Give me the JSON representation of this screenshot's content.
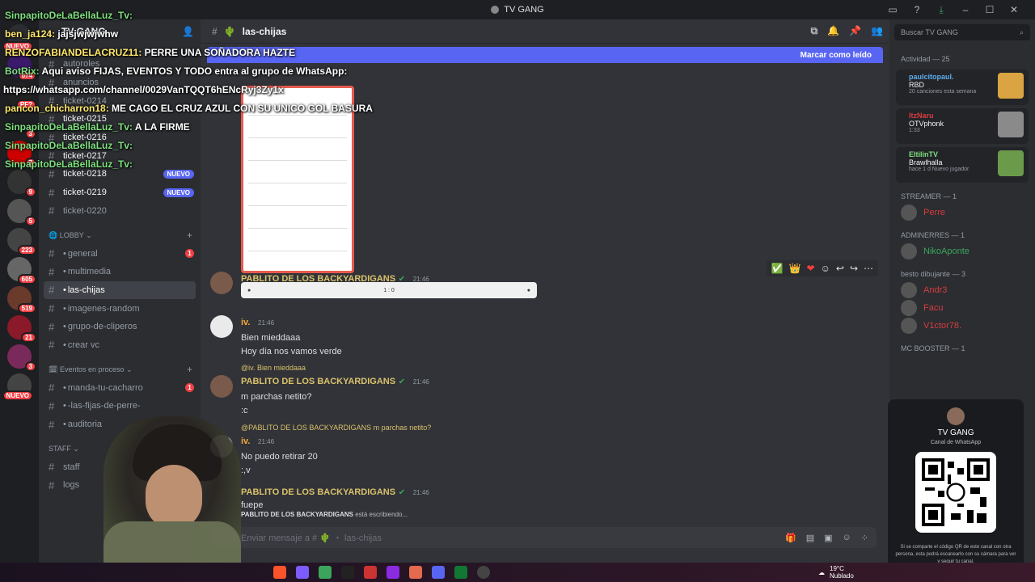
{
  "window": {
    "title": "TV GANG"
  },
  "server": {
    "name": "TV GANG"
  },
  "channels": [
    {
      "name": "autoroles",
      "hash": "#",
      "bright": false
    },
    {
      "name": "anuncios",
      "hash": "#",
      "bright": false
    },
    {
      "name": "ticket-0214",
      "hash": "#",
      "bright": false
    },
    {
      "name": "ticket-0215",
      "hash": "#",
      "bright": true
    },
    {
      "name": "ticket-0216",
      "hash": "#",
      "bright": true
    },
    {
      "name": "ticket-0217",
      "hash": "#",
      "bright": true
    },
    {
      "name": "ticket-0218",
      "hash": "#",
      "bright": true,
      "badge": "NUEVO"
    },
    {
      "name": "ticket-0219",
      "hash": "#",
      "bright": true,
      "badge": "NUEVO"
    },
    {
      "name": "ticket-0220",
      "hash": "#",
      "bright": false
    }
  ],
  "lobby": {
    "label": "LOBBY",
    "items": [
      {
        "name": "general",
        "count": "1"
      },
      {
        "name": "multimedia"
      },
      {
        "name": "las-chijas",
        "active": true
      },
      {
        "name": "imagenes-random"
      },
      {
        "name": "grupo-de-cliperos"
      },
      {
        "name": "crear vc"
      }
    ]
  },
  "events": {
    "label": "Eventos en proceso",
    "items": [
      {
        "name": "manda-tu-cacharro",
        "count": "1"
      },
      {
        "name": "-las-fijas-de-perre-"
      },
      {
        "name": "auditoria"
      }
    ]
  },
  "staff": {
    "label": "STAFF",
    "items": [
      {
        "name": "staff"
      },
      {
        "name": "logs"
      }
    ]
  },
  "server_badges": [
    "NUEVO",
    "674",
    "PF?",
    "3",
    "7",
    "9",
    "5",
    "223",
    "605",
    "519",
    "21",
    "3",
    "NUEVO"
  ],
  "main": {
    "channel": "las-chijas",
    "newbar_mark": "Marcar como leído",
    "messages": [
      {
        "author": "PABLITO DE LOS BACKYARDIGANS",
        "time": "21:46",
        "text": ""
      },
      {
        "author": "iv.",
        "time": "21:46",
        "lines": [
          "Bien mieddaaa",
          "Hoy día nos vamos verde"
        ]
      },
      {
        "reply": "@iv. Bien mieddaaa",
        "author": "PABLITO DE LOS BACKYARDIGANS",
        "time": "21:46",
        "lines": [
          "m parchas netito?",
          ":c"
        ]
      },
      {
        "reply": "@PABLITO DE LOS BACKYARDIGANS m parchas netito?",
        "author": "iv.",
        "time": "21:46",
        "lines": [
          "No puedo retirar 20",
          ":,v"
        ]
      },
      {
        "author": "PABLITO DE LOS BACKYARDIGANS",
        "time": "21:46",
        "lines": [
          "fuepe"
        ]
      }
    ],
    "typing": {
      "who": "PABLITO DE LOS BACKYARDIGANS",
      "text": " está escribiendo..."
    },
    "composer_placeholder": "Enviar mensaje a # 🌵 ・ las-chijas"
  },
  "members": {
    "search_placeholder": "Buscar TV GANG",
    "activity_label": "Actividad — 25",
    "activities": [
      {
        "name": "paulcitopaul.",
        "title": "RBD",
        "detail": "20 canciones esta semana",
        "color": "#5dadec"
      },
      {
        "name": "ItzNaru",
        "title": "OTVphonk",
        "detail": "1:33",
        "color": "#d83c3e"
      },
      {
        "name": "EltilinTV",
        "title": "Brawlhalla",
        "detail": "hace 1 d    Nuevo jugador",
        "color": "#7fe07f"
      }
    ],
    "groups": [
      {
        "label": "STREAMER — 1",
        "members": [
          {
            "name": "Perre",
            "color": "#d83c3e"
          }
        ]
      },
      {
        "label": "ADMINERRES — 1",
        "members": [
          {
            "name": "NikoAponte",
            "color": "#3ba55d"
          }
        ]
      },
      {
        "label": "besto dibujante — 3",
        "members": [
          {
            "name": "Andr3",
            "color": "#d83c3e"
          },
          {
            "name": "Facu",
            "color": "#d83c3e"
          },
          {
            "name": "V1ctor78.",
            "color": "#d83c3e"
          }
        ]
      },
      {
        "label": "MC BOOSTER — 1",
        "members": []
      }
    ]
  },
  "qr": {
    "title": "TV GANG",
    "subtitle": "Canal de WhatsApp",
    "note": "Si se comparte el código QR de este canal con otra persona, esta podrá escanearlo con su cámara para ver y seguir tu canal."
  },
  "overlay": [
    {
      "user": "SinpapitoDeLaBellaLuz_Tv:",
      "text": "",
      "color": "#7fe07f"
    },
    {
      "user": "ben_ja124:",
      "text": " jajsjwjwjwhw",
      "color": "#ffe86b"
    },
    {
      "user": "RENZOFABIANDELACRUZ11:",
      "text": " PERRE UNA SOÑADORA HAZTE",
      "color": "#ffe86b"
    },
    {
      "user": "BotRix:",
      "text": " Aqui aviso FIJAS, EVENTOS Y TODO entra al grupo de WhatsApp:",
      "color": "#7fe07f"
    },
    {
      "user": "",
      "text": "https://whatsapp.com/channel/0029VanTQQT6hENcRyj3Zy1x",
      "color": "#fff"
    },
    {
      "user": "pancon_chicharron18:",
      "text": " ME CAGO EL CRUZ AZUL CON SU UNICO GOL BASURA",
      "color": "#ffe86b"
    },
    {
      "user": "SinpapitoDeLaBellaLuz_Tv:",
      "text": " A LA FIRME",
      "color": "#7fe07f"
    },
    {
      "user": "SinpapitoDeLaBellaLuz_Tv:",
      "text": "",
      "color": "#7fe07f"
    },
    {
      "user": "SinpapitoDeLaBellaLuz_Tv:",
      "text": "",
      "color": "#7fe07f"
    }
  ],
  "taskbar": {
    "temp": "19°C",
    "weather": "Nublado"
  }
}
